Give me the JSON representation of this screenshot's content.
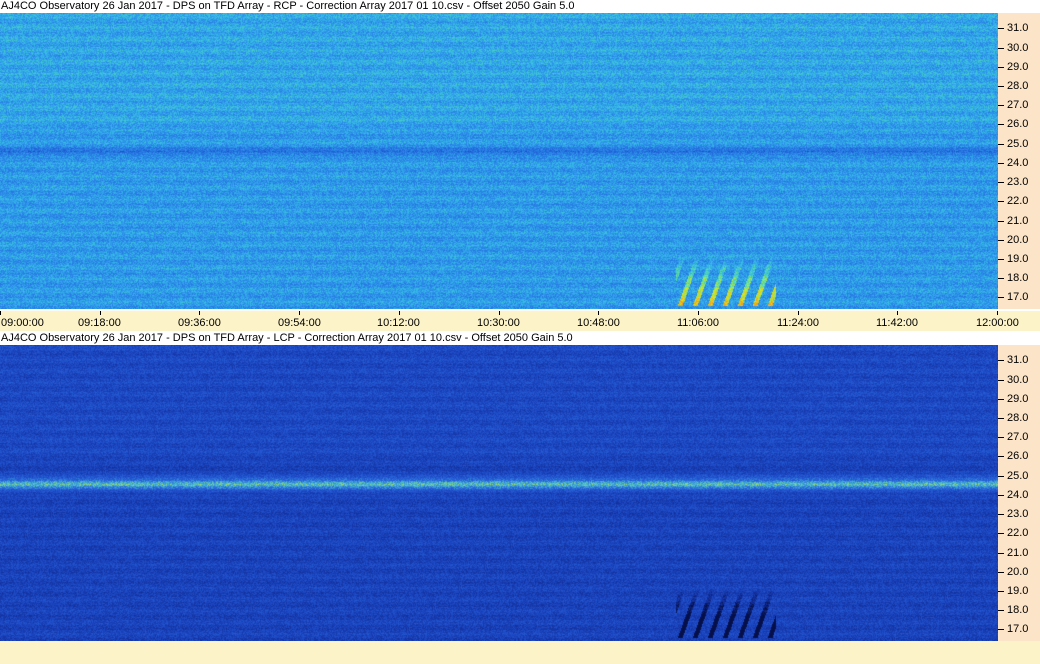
{
  "chart_data": [
    {
      "type": "heatmap",
      "title": "AJ4CO Observatory 26 Jan 2017  -  DPS on TFD Array  -  RCP  -  Correction Array 2017 01 10.csv  -  Offset 2050  Gain 5.0",
      "polarization": "RCP",
      "x_ticks": [
        "09:00:00",
        "09:18:00",
        "09:36:00",
        "09:54:00",
        "10:12:00",
        "10:30:00",
        "10:48:00",
        "11:06:00",
        "11:24:00",
        "11:42:00",
        "12:00:00"
      ],
      "y_ticks": [
        "31.0",
        "30.0",
        "29.0",
        "28.0",
        "27.0",
        "26.0",
        "25.0",
        "24.0",
        "23.0",
        "22.0",
        "21.0",
        "20.0",
        "19.0",
        "18.0",
        "17.0"
      ],
      "xlim": [
        "09:00:00",
        "12:00:00"
      ],
      "ylim": [
        16.4,
        31.8
      ],
      "colormap": [
        "#0a1e8c",
        "#1f5fd6",
        "#2a86e8",
        "#35b8e8",
        "#5de0a0",
        "#d8e820",
        "#f0a020"
      ],
      "features": {
        "dark_band_freq": 24.6,
        "burst_time_range": [
          "11:02:00",
          "11:20:00"
        ],
        "burst_freq_range": [
          16.6,
          19.2
        ]
      }
    },
    {
      "type": "heatmap",
      "title": "AJ4CO Observatory 26 Jan 2017  -  DPS on TFD Array  -  LCP  -  Correction Array 2017 01 10.csv  -  Offset 2050  Gain 5.0",
      "polarization": "LCP",
      "x_ticks": [],
      "y_ticks": [
        "31.0",
        "30.0",
        "29.0",
        "28.0",
        "27.0",
        "26.0",
        "25.0",
        "24.0",
        "23.0",
        "22.0",
        "21.0",
        "20.0",
        "19.0",
        "18.0",
        "17.0"
      ],
      "xlim": [
        "09:00:00",
        "12:00:00"
      ],
      "ylim": [
        16.4,
        31.8
      ],
      "colormap": [
        "#05104a",
        "#122e9a",
        "#1c48c4",
        "#2a66dc",
        "#45b8d0",
        "#d8f020"
      ],
      "features": {
        "bright_band_freq": 24.6,
        "burst_time_range": [
          "11:02:00",
          "11:20:00"
        ],
        "burst_freq_range": [
          16.6,
          19.2
        ]
      }
    }
  ]
}
